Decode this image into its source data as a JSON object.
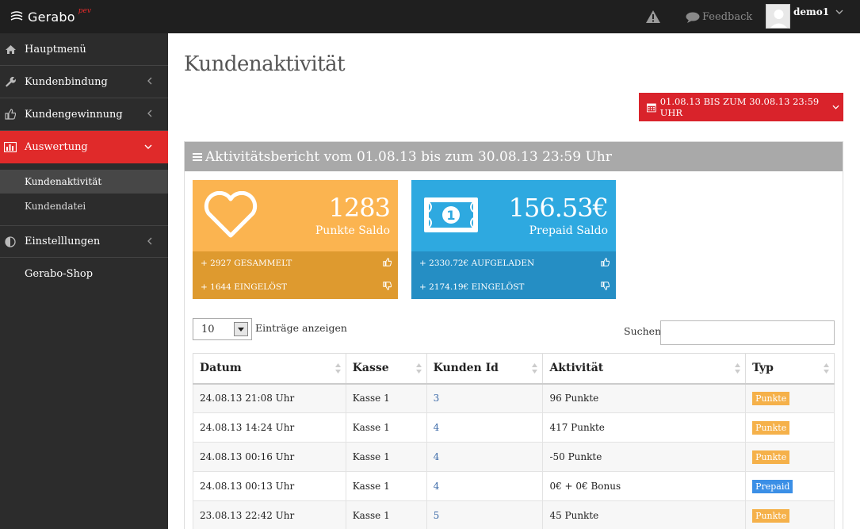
{
  "brand": {
    "name": "Gerabo",
    "sup": "pev"
  },
  "header": {
    "feedback_label": "Feedback",
    "user_name": "demo1"
  },
  "sidebar": {
    "items": [
      {
        "label": "Hauptmenü",
        "icon": "home-icon"
      },
      {
        "label": "Kundenbindung",
        "icon": "wrench-icon"
      },
      {
        "label": "Kundengewinnung",
        "icon": "thumbs-up-icon"
      },
      {
        "label": "Auswertung",
        "icon": "bar-chart-icon"
      },
      {
        "label": "Einstelllungen",
        "icon": "adjust-icon"
      },
      {
        "label": "Gerabo-Shop",
        "icon": ""
      }
    ],
    "subitems": [
      {
        "label": "Kundenaktivität"
      },
      {
        "label": "Kundendatei"
      }
    ]
  },
  "main": {
    "title": "Kundenaktivität",
    "date_range": "01.08.13 BIS ZUM 30.08.13 23:59 UHR",
    "report_title": "Aktivitätsbericht vom 01.08.13 bis zum 30.08.13 23:59 Uhr"
  },
  "stats": {
    "points": {
      "value": "1283",
      "label": "Punkte Saldo",
      "collected": "+ 2927 GESAMMELT",
      "redeemed": "+ 1644 EINGELÖST"
    },
    "prepaid": {
      "value": "156.53€",
      "label": "Prepaid Saldo",
      "loaded": "+ 2330.72€ AUFGELADEN",
      "redeemed": "+ 2174.19€ EINGELÖST"
    }
  },
  "table_controls": {
    "page_length": "10",
    "length_label": "Einträge anzeigen",
    "search_label": "Suchen"
  },
  "table": {
    "columns": [
      "Datum",
      "Kasse",
      "Kunden Id",
      "Aktivität",
      "Typ"
    ],
    "rows": [
      {
        "datum": "24.08.13 21:08 Uhr",
        "kasse": "Kasse 1",
        "kunden_id": "3",
        "aktivitaet": "96 Punkte",
        "typ": "Punkte"
      },
      {
        "datum": "24.08.13 14:24 Uhr",
        "kasse": "Kasse 1",
        "kunden_id": "4",
        "aktivitaet": "417 Punkte",
        "typ": "Punkte"
      },
      {
        "datum": "24.08.13 00:16 Uhr",
        "kasse": "Kasse 1",
        "kunden_id": "4",
        "aktivitaet": "-50 Punkte",
        "typ": "Punkte"
      },
      {
        "datum": "24.08.13 00:13 Uhr",
        "kasse": "Kasse 1",
        "kunden_id": "4",
        "aktivitaet": "0€ + 0€ Bonus",
        "typ": "Prepaid"
      },
      {
        "datum": "23.08.13 22:42 Uhr",
        "kasse": "Kasse 1",
        "kunden_id": "5",
        "aktivitaet": "45 Punkte",
        "typ": "Punkte"
      }
    ]
  },
  "colors": {
    "topbar": "#1f1f1f",
    "sidebar": "#2c2c2c",
    "active_red": "#e02a2a",
    "orange": "#fbb450",
    "blue": "#2ea9e0",
    "badge_punkte": "#f5b14a",
    "badge_prepaid": "#3b8fe6"
  }
}
